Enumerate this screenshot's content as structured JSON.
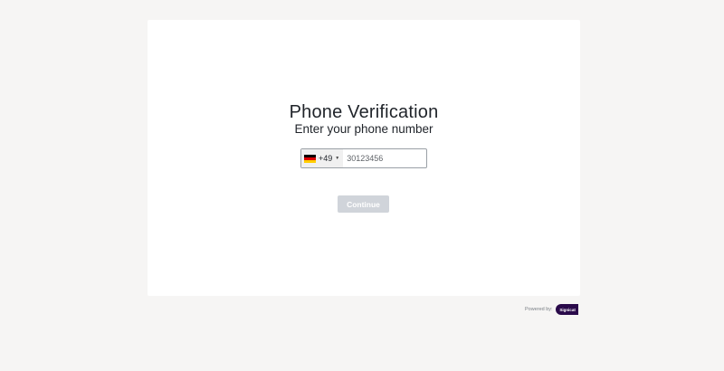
{
  "card": {
    "title": "Phone Verification",
    "subtitle": "Enter your phone number"
  },
  "phone": {
    "country_flag": "germany-flag-icon",
    "flag_colors": [
      "#000000",
      "#dd0000",
      "#ffce00"
    ],
    "dial_code": "+49",
    "placeholder": "30123456",
    "value": ""
  },
  "continue_button": {
    "label": "Continue",
    "enabled": false,
    "color": "#d0d4da"
  },
  "footer": {
    "powered_by_label": "Powered by:",
    "logo_text": "Signicat",
    "logo_color": "#2a0a4a"
  }
}
